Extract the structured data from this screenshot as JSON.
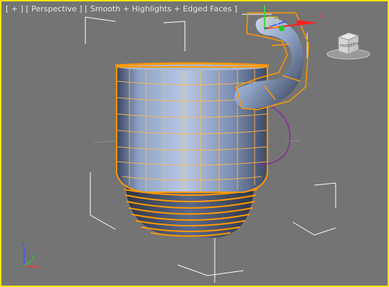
{
  "viewport": {
    "label_plus": "[ + ]",
    "label_view": "[ Perspective ]",
    "label_shading": "[ Smooth + Highlights + Edged Faces ]",
    "border_color": "#ffe600",
    "background": "#747474"
  },
  "viewcube": {
    "front": "FRONT",
    "left": "LEFT"
  },
  "gizmo": {
    "x": "x",
    "y": "y",
    "z": "z"
  },
  "axis_tripod": {
    "x": "x",
    "y": "y",
    "z": "z"
  },
  "selection_color": "#ff9900",
  "mug_color": "#8ea3c8"
}
